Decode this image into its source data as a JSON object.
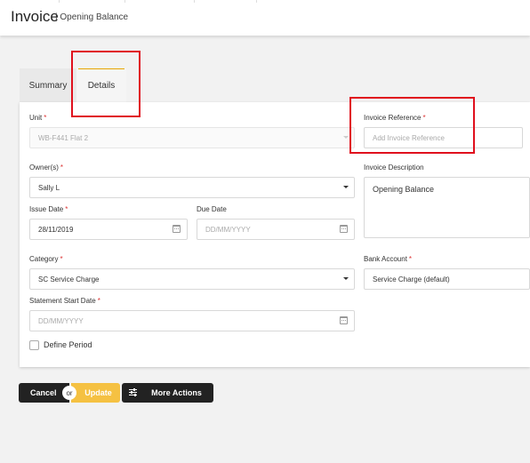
{
  "header": {
    "title": "Invoice",
    "subtitle": "| Opening Balance"
  },
  "tabs": [
    {
      "label": "Summary"
    },
    {
      "label": "Details"
    }
  ],
  "form": {
    "unit": {
      "label": "Unit",
      "value": "WB-F441 Flat 2"
    },
    "owners": {
      "label": "Owner(s)",
      "value": "Sally L"
    },
    "issue_date": {
      "label": "Issue Date",
      "value": "28/11/2019"
    },
    "due_date": {
      "label": "Due Date",
      "placeholder": "DD/MM/YYYY"
    },
    "category": {
      "label": "Category",
      "value": "SC Service Charge"
    },
    "statement_start_date": {
      "label": "Statement Start Date",
      "placeholder": "DD/MM/YYYY"
    },
    "define_period": {
      "label": "Define Period",
      "checked": false
    },
    "invoice_reference": {
      "label": "Invoice Reference",
      "placeholder": "Add Invoice Reference"
    },
    "invoice_description": {
      "label": "Invoice Description",
      "value": "Opening Balance"
    },
    "bank_account": {
      "label": "Bank Account",
      "value": "Service Charge (default)"
    },
    "required_marker": "*"
  },
  "actions": {
    "cancel": "Cancel",
    "or": "or",
    "update": "Update",
    "more": "More Actions"
  },
  "colors": {
    "accent": "#f5c142",
    "highlight": "#e0101d",
    "button_dark": "#222222",
    "tab_underline": "#e8a400"
  },
  "icons": {
    "calendar": "calendar-icon",
    "dropdown": "chevron-down-icon",
    "more_actions": "sliders-icon"
  }
}
